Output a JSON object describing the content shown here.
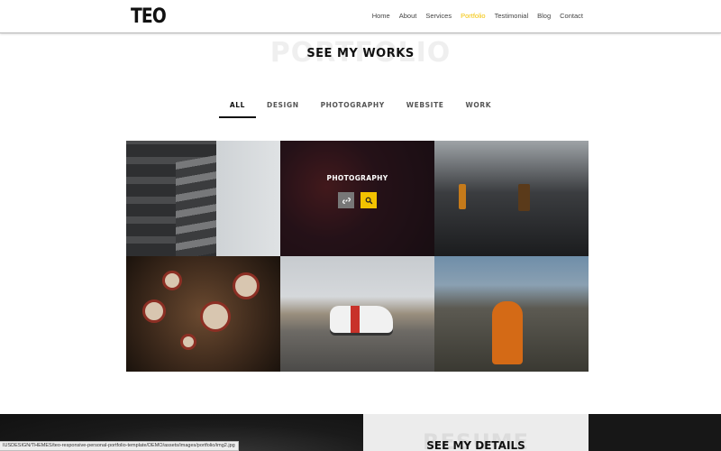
{
  "header": {
    "logo": "TEO",
    "nav": [
      "Home",
      "About",
      "Services",
      "Portfolio",
      "Testimonial",
      "Blog",
      "Contact"
    ],
    "active_nav": "Portfolio",
    "accent_color": "#f2c200"
  },
  "portfolio": {
    "ghost_title": "PORTFOLIO",
    "title": "SEE MY WORKS",
    "filters": [
      "ALL",
      "DESIGN",
      "PHOTOGRAPHY",
      "WEBSITE",
      "WORK"
    ],
    "active_filter": "ALL",
    "hovered_item_label": "PHOTOGRAPHY",
    "hover_icons": [
      "link-icon",
      "search-icon"
    ]
  },
  "resume": {
    "ghost_title": "RESUME",
    "title": "SEE MY DETAILS"
  },
  "status_bar": {
    "url": "IUSDESIGN/THEMES/teo-responsive-personal-portfolio-template/DEMO/assets/images/portfolio/img2.jpg"
  }
}
